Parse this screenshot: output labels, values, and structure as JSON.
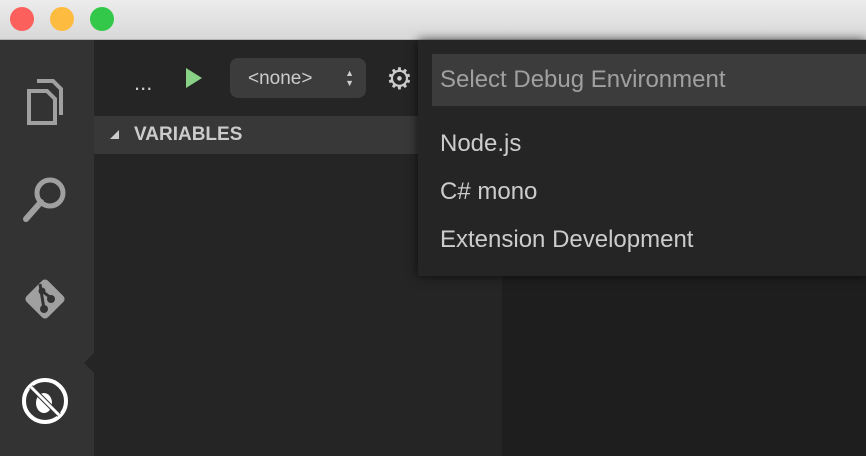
{
  "window": {
    "controls": {
      "close": "#fc605c",
      "minimize": "#fdbc40",
      "zoom": "#34c84a"
    }
  },
  "activity_bar": {
    "items": [
      "explorer-icon",
      "search-icon",
      "git-icon",
      "debug-icon"
    ]
  },
  "debug_toolbar": {
    "more_label": "...",
    "config_select": "<none>",
    "start_color": "#89d185"
  },
  "sidebar": {
    "section_title": "VARIABLES"
  },
  "quick_pick": {
    "placeholder": "Select Debug Environment",
    "options": [
      "Node.js",
      "C# mono",
      "Extension Development"
    ]
  }
}
